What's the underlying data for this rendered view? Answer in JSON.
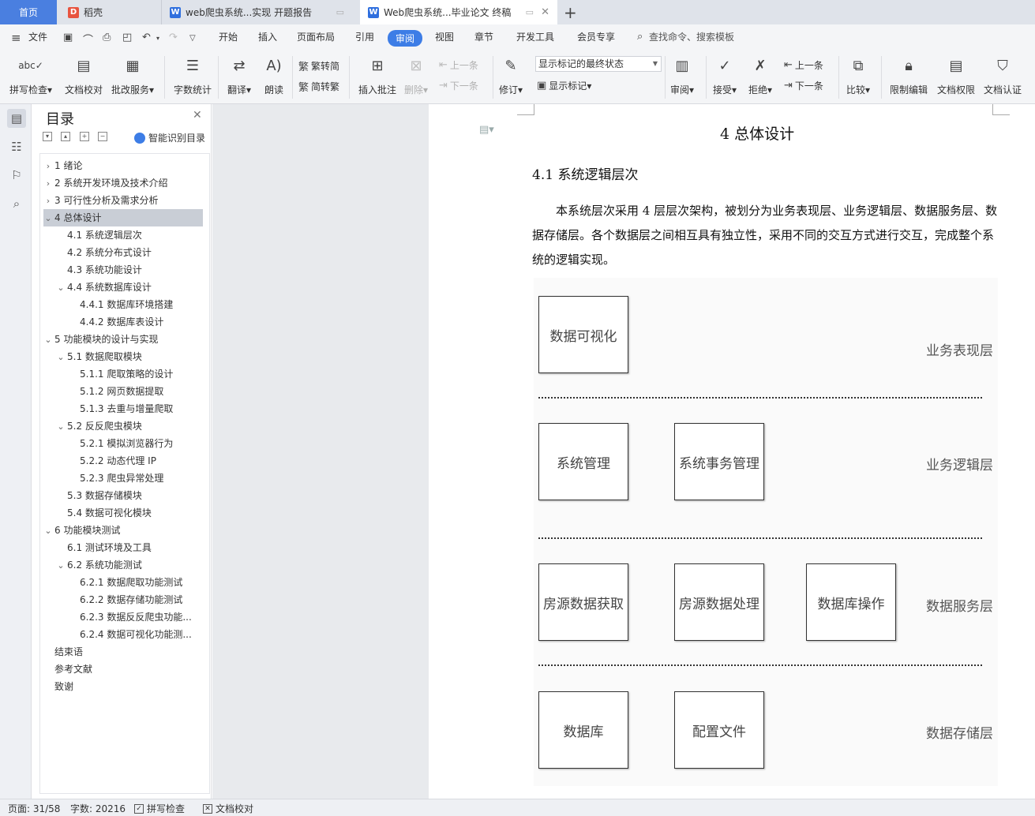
{
  "tabs": {
    "home": "首页",
    "tab1": "稻壳",
    "tab2": "web爬虫系统...实现 开题报告",
    "tab3": "Web爬虫系统...毕业论文 终稿"
  },
  "menu": {
    "file": "文件",
    "items": [
      "开始",
      "插入",
      "页面布局",
      "引用",
      "审阅",
      "视图",
      "章节",
      "开发工具",
      "会员专享"
    ],
    "search": "查找命令、搜索模板"
  },
  "ribbon": {
    "spell": "拼写检查",
    "proofread": "文档校对",
    "correct": "批改服务",
    "wordcount": "字数统计",
    "translate": "翻译",
    "read": "朗读",
    "to_trad": "繁转简",
    "to_simp": "简转繁",
    "insert_comment": "插入批注",
    "delete": "删除",
    "prev": "上一条",
    "next": "下一条",
    "revise": "修订",
    "markup_state": "显示标记的最终状态",
    "show_markup": "显示标记",
    "review": "审阅",
    "accept": "接受",
    "reject": "拒绝",
    "prev2": "上一条",
    "next2": "下一条",
    "compare": "比较",
    "restrict": "限制编辑",
    "permission": "文档权限",
    "certify": "文档认证"
  },
  "toc": {
    "title": "目录",
    "smart": "智能识别目录",
    "items": [
      {
        "toggle": ">",
        "text": "1  绪论"
      },
      {
        "toggle": ">",
        "text": "2  系统开发环境及技术介绍"
      },
      {
        "toggle": ">",
        "text": "3  可行性分析及需求分析"
      },
      {
        "toggle": "v",
        "text": "4  总体设计"
      },
      {
        "toggle": "",
        "text": "4.1  系统逻辑层次"
      },
      {
        "toggle": "",
        "text": "4.2  系统分布式设计"
      },
      {
        "toggle": "",
        "text": "4.3  系统功能设计"
      },
      {
        "toggle": "v",
        "text": "4.4  系统数据库设计"
      },
      {
        "toggle": "",
        "text": "4.4.1  数据库环境搭建"
      },
      {
        "toggle": "",
        "text": "4.4.2  数据库表设计"
      },
      {
        "toggle": "v",
        "text": "5  功能模块的设计与实现"
      },
      {
        "toggle": "v",
        "text": "5.1  数据爬取模块"
      },
      {
        "toggle": "",
        "text": "5.1.1  爬取策略的设计"
      },
      {
        "toggle": "",
        "text": "5.1.2  网页数据提取"
      },
      {
        "toggle": "",
        "text": "5.1.3  去重与增量爬取"
      },
      {
        "toggle": "v",
        "text": "5.2  反反爬虫模块"
      },
      {
        "toggle": "",
        "text": "5.2.1  模拟浏览器行为"
      },
      {
        "toggle": "",
        "text": "5.2.2  动态代理 IP"
      },
      {
        "toggle": "",
        "text": "5.2.3  爬虫异常处理"
      },
      {
        "toggle": "",
        "text": "5.3  数据存储模块"
      },
      {
        "toggle": "",
        "text": "5.4  数据可视化模块"
      },
      {
        "toggle": "v",
        "text": "6  功能模块测试"
      },
      {
        "toggle": "",
        "text": "6.1  测试环境及工具"
      },
      {
        "toggle": "v",
        "text": "6.2  系统功能测试"
      },
      {
        "toggle": "",
        "text": "6.2.1  数据爬取功能测试"
      },
      {
        "toggle": "",
        "text": "6.2.2  数据存储功能测试"
      },
      {
        "toggle": "",
        "text": "6.2.3  数据反反爬虫功能..."
      },
      {
        "toggle": "",
        "text": "6.2.4  数据可视化功能测..."
      },
      {
        "toggle": "",
        "text": "结束语"
      },
      {
        "toggle": "",
        "text": "参考文献"
      },
      {
        "toggle": "",
        "text": "致谢"
      }
    ]
  },
  "doc": {
    "heading": "4  总体设计",
    "subheading": "4.1  系统逻辑层次",
    "paragraph": "本系统层次采用 4 层层次架构，被划分为业务表现层、业务逻辑层、数据服务层、数据存储层。各个数据层之间相互具有独立性，采用不同的交互方式进行交互，完成整个系统的逻辑实现。",
    "diagram": {
      "layers": [
        "业务表现层",
        "业务逻辑层",
        "数据服务层",
        "数据存储层"
      ],
      "boxes": [
        "数据可视化",
        "系统管理",
        "系统事务管理",
        "房源数据获取",
        "房源数据处理",
        "数据库操作",
        "数据库",
        "配置文件"
      ]
    }
  },
  "status": {
    "page": "页面: 31/58",
    "words": "字数: 20216",
    "spell": "拼写检查",
    "proof": "文档校对"
  }
}
